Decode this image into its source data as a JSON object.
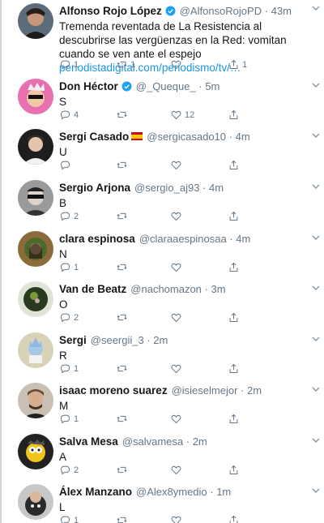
{
  "tweets": [
    {
      "name": "Alfonso Rojo López",
      "handle": "@AlfonsoRojoPD · 43m",
      "verified": true,
      "flag": false,
      "text": "Tremenda reventada de La Resistencia al descubrirse las vergüenzas en la Red: vomitan cuando se ven ante el espejo",
      "link": "periodistadigital.com/periodismo/tv/…",
      "replies": "1",
      "retweets": "1",
      "likes": "",
      "shares": "1",
      "avatar_color": "#3a2a1e"
    },
    {
      "name": "Don Héctor",
      "handle": "@_Queque_ · 5m",
      "verified": true,
      "flag": false,
      "text": "S",
      "replies": "4",
      "retweets": "",
      "likes": "12",
      "shares": "",
      "avatar_color": "#e86fb0"
    },
    {
      "name": "Sergi Casado",
      "handle": "@sergicasado10 · 4m",
      "verified": false,
      "flag": true,
      "text": "U",
      "replies": "",
      "retweets": "",
      "likes": "",
      "shares": "",
      "avatar_color": "#1e1e1e"
    },
    {
      "name": "Sergio Arjona",
      "handle": "@sergio_aj93 · 4m",
      "verified": false,
      "flag": false,
      "text": "B",
      "replies": "2",
      "retweets": "",
      "likes": "",
      "shares": "",
      "avatar_color": "#6d6d6d"
    },
    {
      "name": "clara espinosa",
      "handle": "@claraaespinosaa · 4m",
      "verified": false,
      "flag": false,
      "text": "N",
      "replies": "1",
      "retweets": "",
      "likes": "",
      "shares": "",
      "avatar_color": "#7a5a2a"
    },
    {
      "name": "Van de Beatz",
      "handle": "@nachomazon · 3m",
      "verified": false,
      "flag": false,
      "text": "O",
      "replies": "2",
      "retweets": "",
      "likes": "",
      "shares": "",
      "avatar_color": "#2e3a22"
    },
    {
      "name": "Sergi",
      "handle": "@seergii_3 · 2m",
      "verified": false,
      "flag": false,
      "text": "R",
      "replies": "1",
      "retweets": "",
      "likes": "",
      "shares": "",
      "avatar_color": "#d8d2b8"
    },
    {
      "name": "isaac moreno suarez",
      "handle": "@isieselmejor · 2m",
      "verified": false,
      "flag": false,
      "text": "M",
      "replies": "1",
      "retweets": "",
      "likes": "",
      "shares": "",
      "avatar_color": "#5a4a3a"
    },
    {
      "name": "Salva Mesa",
      "handle": "@salvamesa · 2m",
      "verified": false,
      "flag": false,
      "text": "A",
      "replies": "2",
      "retweets": "",
      "likes": "",
      "shares": "",
      "avatar_color": "#f2c318"
    },
    {
      "name": "Álex Manzano",
      "handle": "@Alex8ymedio · 1m",
      "verified": false,
      "flag": false,
      "text": "L",
      "replies": "1",
      "retweets": "",
      "likes": "",
      "shares": "",
      "avatar_color": "#3a3a3a"
    }
  ],
  "icons": {
    "reply": "reply-icon",
    "retweet": "retweet-icon",
    "like": "like-icon",
    "share": "share-icon",
    "verified": "verified-badge-icon",
    "more": "chevron-down-icon",
    "flag": "spain-flag-icon"
  },
  "colors": {
    "accent": "#1b95e0",
    "verified": "#1da1f2",
    "muted": "#657786",
    "text": "#14171a"
  }
}
